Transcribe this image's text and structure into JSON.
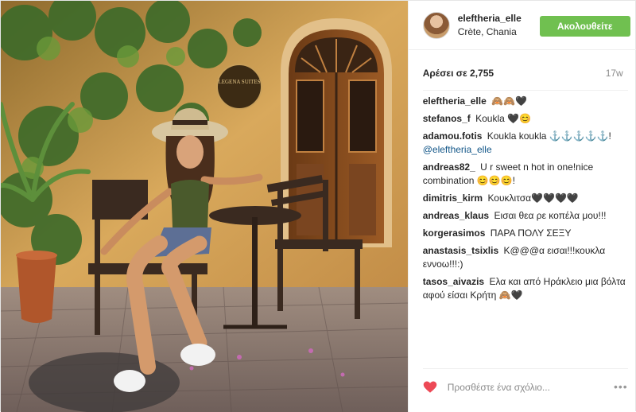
{
  "post": {
    "username": "eleftheria_elle",
    "location": "Crète, Chania",
    "follow_label": "Ακολουθείτε",
    "likes": "Αρέσει σε 2,755",
    "time_ago": "17w"
  },
  "comments": [
    {
      "user": "eleftheria_elle",
      "text": "🙈🙈🖤"
    },
    {
      "user": "stefanos_f",
      "text": "Koukla 🖤😊"
    },
    {
      "user": "adamou.fotis",
      "text": "Koukla koukla ⚓⚓⚓⚓⚓!",
      "mention": "@eleftheria_elle"
    },
    {
      "user": "andreas82_",
      "text": "U r sweet n hot in one!nice combination 😊😊😊!"
    },
    {
      "user": "dimitris_kirm",
      "text": "Κουκλιτσα🖤🖤🖤🖤"
    },
    {
      "user": "andreas_klaus",
      "text": "Εισαι θεα ρε κοπέλα μου!!!"
    },
    {
      "user": "korgerasimos",
      "text": "ΠΑΡΑ ΠΟΛΥ ΣΕΞΥ"
    },
    {
      "user": "anastasis_tsixlis",
      "text": "Κ@@@α εισαι!!!κουκλα εννοω!!!:)"
    },
    {
      "user": "tasos_aivazis",
      "text": "Ελα και από Ηράκλειο μια βόλτα αφού είσαι Κρήτη 🙈🖤"
    }
  ],
  "comment_box": {
    "placeholder": "Προσθέστε ένα σχόλιο...",
    "more": "•••"
  },
  "photo": {
    "sign_text": "LEGENA SUITES"
  },
  "colors": {
    "follow": "#70c050",
    "heart": "#ed4956",
    "mention": "#125688"
  }
}
